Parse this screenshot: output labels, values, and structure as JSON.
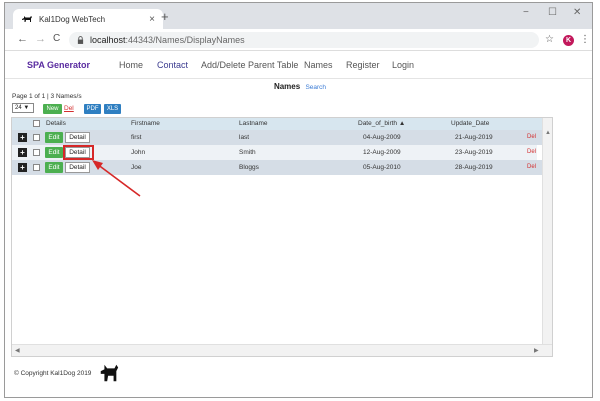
{
  "browser": {
    "tab_title": "Kal1Dog WebTech",
    "tab_close": "×",
    "new_tab": "+",
    "window_controls": [
      "−",
      "☐",
      "✕"
    ],
    "back": "←",
    "forward": "→",
    "reload": "C",
    "url_host": "localhost",
    "url_rest": ":44343/Names/DisplayNames",
    "star": "☆",
    "profile_initial": "K",
    "menu": "⋮"
  },
  "appmenu": {
    "brand": "SPA Generator",
    "items": [
      "Home",
      "Contact",
      "Add/Delete Parent Table",
      "Names",
      "Register",
      "Login"
    ]
  },
  "content": {
    "title": "Names",
    "search_link": "Search",
    "pager": "Page 1 of 1  |  3 Names/s",
    "page_size": "24 ▼",
    "new_label": "New",
    "del_label": "Del",
    "pdf_label": "PDF",
    "xls_label": "XLS"
  },
  "table": {
    "headers": [
      "Details",
      "Firstname",
      "Lastname",
      "Date_of_birth ▲",
      "Update_Date"
    ],
    "expand_label": "+",
    "edit_label": "Edit",
    "detail_label": "Detail",
    "row_del_label": "Del",
    "rows": [
      {
        "firstname": "first",
        "lastname": "last",
        "dob": "04-Aug-2009",
        "updated": "21-Aug-2019"
      },
      {
        "firstname": "John",
        "lastname": "Smith",
        "dob": "12-Aug-2009",
        "updated": "23-Aug-2019"
      },
      {
        "firstname": "Joe",
        "lastname": "Bloggs",
        "dob": "05-Aug-2010",
        "updated": "28-Aug-2019"
      }
    ],
    "scroll_up": "▲",
    "scroll_left": "◀",
    "scroll_right": "▶"
  },
  "footer": {
    "copyright": "© Copyright Kal1Dog 2019"
  },
  "colors": {
    "brand": "#5a2ca0",
    "edit_green": "#4caf50",
    "export_blue": "#2f7fc1",
    "annotation_red": "#d62828"
  }
}
